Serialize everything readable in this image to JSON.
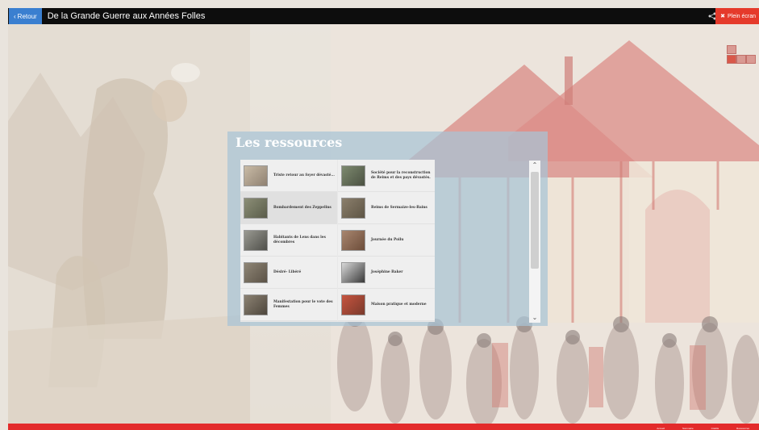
{
  "topbar": {
    "back_label": "Retour",
    "title": "De la Grande Guerre aux Années Folles",
    "fullscreen_label": "Plein écran"
  },
  "panel": {
    "title": "Les ressources",
    "items": [
      {
        "label": "Triste retour au foyer dévasté..."
      },
      {
        "label": "Société pour la reconstruction de Reims et des pays dévastés."
      },
      {
        "label": "Bombardement des Zeppelins"
      },
      {
        "label": "Reims de Sermaize-les-Bains"
      },
      {
        "label": "Habitants de Lens dans les décombres"
      },
      {
        "label": "Journée du Poilu"
      },
      {
        "label": "Désiré- Libéré"
      },
      {
        "label": "Joséphine Baker"
      },
      {
        "label": "Manifestation pour le vote des Femmes"
      },
      {
        "label": "Maison pratique et moderne"
      }
    ]
  },
  "footer": {
    "links": [
      "Accueil",
      "Sommaire",
      "Crédits",
      "Ressources"
    ]
  },
  "colors": {
    "topbar": "#0d0d0d",
    "back_button": "#3a7fd0",
    "fullscreen": "#e53a2b",
    "footer": "#e32b2b",
    "panel": "#a7c4d6"
  }
}
